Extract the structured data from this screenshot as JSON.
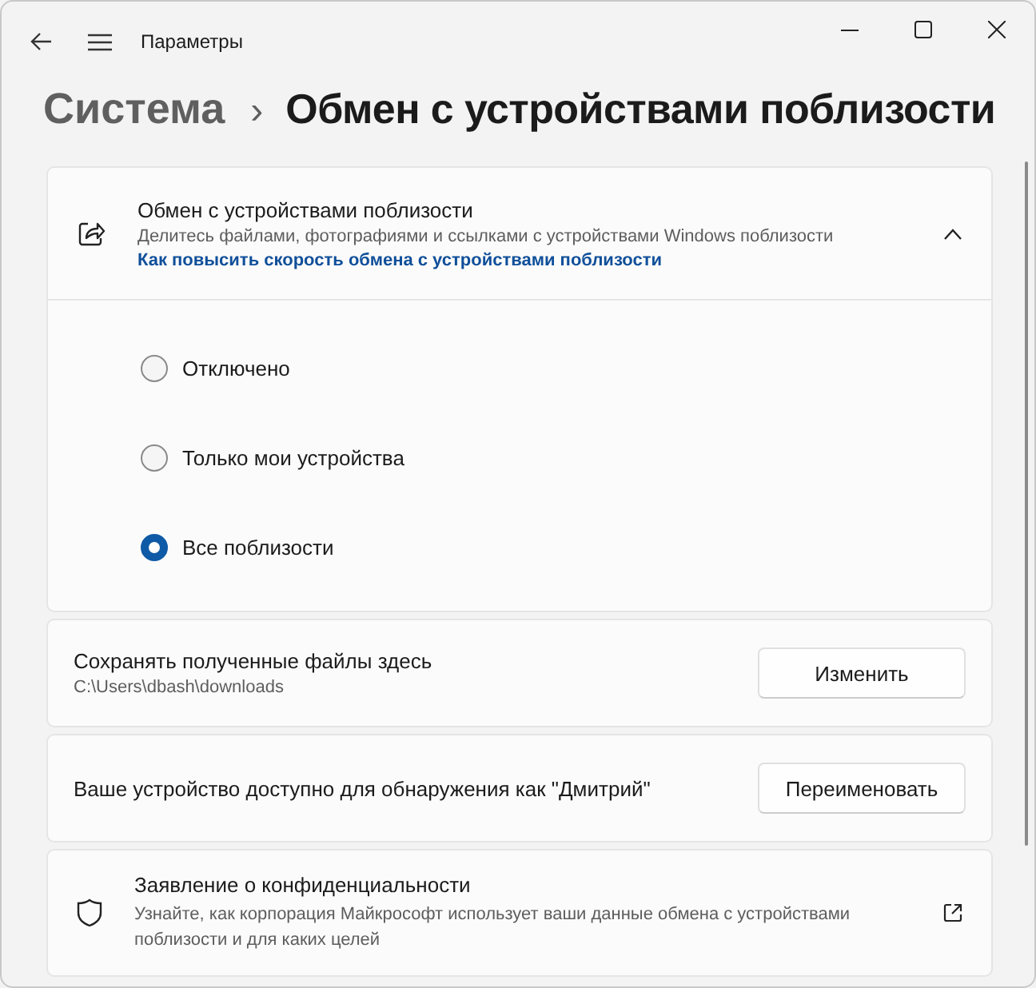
{
  "window": {
    "title": "Параметры"
  },
  "breadcrumb": {
    "parent": "Система",
    "separator": "›",
    "current": "Обмен с устройствами поблизости"
  },
  "sharing": {
    "title": "Обмен с устройствами поблизости",
    "description": "Делитесь файлами, фотографиями и ссылками с устройствами Windows поблизости",
    "link": "Как повысить скорость обмена с устройствами поблизости",
    "expanded": true,
    "options": [
      {
        "label": "Отключено",
        "selected": false
      },
      {
        "label": "Только мои устройства",
        "selected": false
      },
      {
        "label": "Все поблизости",
        "selected": true
      }
    ]
  },
  "save_location": {
    "title": "Сохранять полученные файлы здесь",
    "path": "C:\\Users\\dbash\\downloads",
    "button": "Изменить"
  },
  "discoverable": {
    "title": "Ваше устройство доступно для обнаружения как \"Дмитрий\"",
    "button": "Переименовать"
  },
  "privacy": {
    "title": "Заявление о конфиденциальности",
    "description": "Узнайте, как корпорация Майкрософт использует ваши данные обмена с устройствами поблизости и для каких целей"
  }
}
